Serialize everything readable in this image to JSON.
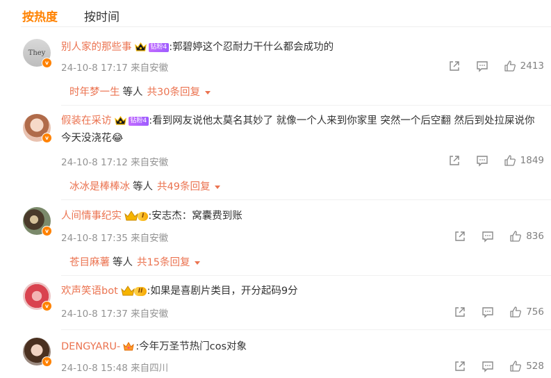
{
  "tabs": {
    "hot": "按热度",
    "time": "按时间"
  },
  "comments": [
    {
      "username": "别人家的那些事",
      "avatar_text": "They",
      "fan_badge": "钻粉4",
      "text": ":郭碧婷这个忍耐力干什么都会成功的",
      "time": "24-10-8 17:17 来自安徽",
      "likes": "2413",
      "reply": {
        "name": "时年梦一生",
        "mid": "等人",
        "total": "共30条回复"
      }
    },
    {
      "username": "假装在采访",
      "fan_badge": "钻粉4",
      "text": ":看到网友说他太莫名其妙了 就像一个人来到你家里 突然一个后空翻 然后到处拉屎说你今天没浇花😂",
      "time": "24-10-8 17:12 来自安徽",
      "likes": "1849",
      "reply": {
        "name": "冰冰是棒棒冰",
        "mid": "等人",
        "total": "共49条回复"
      }
    },
    {
      "username": "人间情事纪实",
      "level_badge": "I",
      "text": ":安志杰：窝囊费到账",
      "time": "24-10-8 17:35 来自安徽",
      "likes": "836",
      "reply": {
        "name": "苍目麻薯",
        "mid": "等人",
        "total": "共15条回复"
      }
    },
    {
      "username": "欢声笑语bot",
      "level_badge": "II",
      "text": ":如果是喜剧片类目，开分起码9分",
      "time": "24-10-8 17:37 来自安徽",
      "likes": "756"
    },
    {
      "username": "DENGYARU-",
      "text": ":今年万圣节热门cos对象",
      "time": "24-10-8 15:48 来自四川",
      "likes": "528"
    }
  ],
  "colors": {
    "accent": "#ff8200",
    "username": "#eb7350",
    "meta": "#939393"
  },
  "icons": [
    "share-icon",
    "comment-icon",
    "like-icon",
    "verified-v-icon",
    "crown-icon"
  ]
}
